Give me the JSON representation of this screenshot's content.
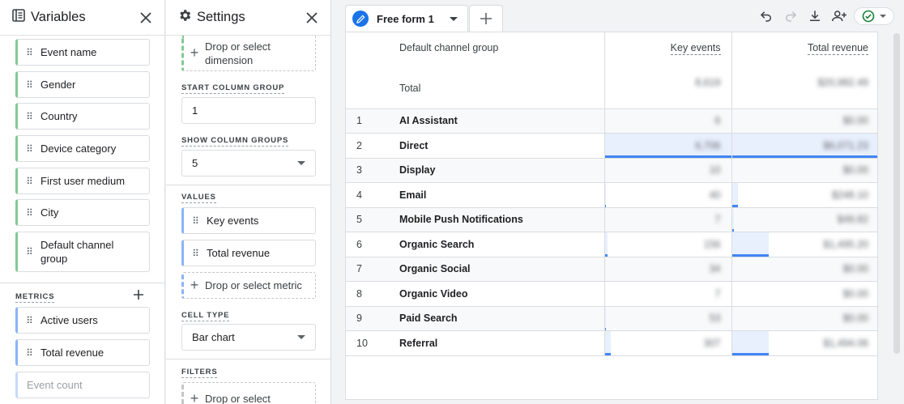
{
  "variables": {
    "title": "Variables",
    "dimensions": [
      "Event name",
      "Gender",
      "Country",
      "Device category",
      "First user medium",
      "City",
      "Default channel group"
    ],
    "metrics_label": "METRICS",
    "metrics": [
      "Active users",
      "Total revenue",
      "Event count"
    ]
  },
  "settings": {
    "title": "Settings",
    "drop_dimension": "Drop or select dimension",
    "start_column_group_label": "START COLUMN GROUP",
    "start_column_group_value": "1",
    "show_column_groups_label": "SHOW COLUMN GROUPS",
    "show_column_groups_value": "5",
    "values_label": "VALUES",
    "values": [
      "Key events",
      "Total revenue"
    ],
    "drop_metric": "Drop or select metric",
    "cell_type_label": "CELL TYPE",
    "cell_type_value": "Bar chart",
    "filters_label": "FILTERS",
    "drop_filter": "Drop or select"
  },
  "tabs": [
    {
      "label": "Free form 1"
    }
  ],
  "colors": {
    "accent": "#1a73e8",
    "dimension_chip": "#81c995",
    "metric_chip": "#8ab4f8",
    "bar_fill": "#e8f0fe",
    "bar_line": "#4285f4",
    "success": "#188038"
  },
  "table": {
    "dimension_header": "Default channel group",
    "metric_headers": [
      "Key events",
      "Total revenue"
    ],
    "total_label": "Total",
    "totals": [
      "8,619",
      "$20,982.49"
    ],
    "rows": [
      {
        "idx": "1",
        "name": "AI Assistant",
        "key_events": "6",
        "revenue": "$0.00",
        "ke_bar": 0,
        "rev_bar": 0
      },
      {
        "idx": "2",
        "name": "Direct",
        "key_events": "6,706",
        "revenue": "$6,071.23",
        "ke_bar": 1.0,
        "rev_bar": 1.0
      },
      {
        "idx": "3",
        "name": "Display",
        "key_events": "10",
        "revenue": "$0.00",
        "ke_bar": 0,
        "rev_bar": 0
      },
      {
        "idx": "4",
        "name": "Email",
        "key_events": "40",
        "revenue": "$248.10",
        "ke_bar": 0.01,
        "rev_bar": 0.04
      },
      {
        "idx": "5",
        "name": "Mobile Push Notifications",
        "key_events": "7",
        "revenue": "$49.82",
        "ke_bar": 0,
        "rev_bar": 0.01
      },
      {
        "idx": "6",
        "name": "Organic Search",
        "key_events": "156",
        "revenue": "$1,495.20",
        "ke_bar": 0.02,
        "rev_bar": 0.25
      },
      {
        "idx": "7",
        "name": "Organic Social",
        "key_events": "34",
        "revenue": "$0.00",
        "ke_bar": 0,
        "rev_bar": 0
      },
      {
        "idx": "8",
        "name": "Organic Video",
        "key_events": "7",
        "revenue": "$0.00",
        "ke_bar": 0,
        "rev_bar": 0
      },
      {
        "idx": "9",
        "name": "Paid Search",
        "key_events": "53",
        "revenue": "$0.00",
        "ke_bar": 0.01,
        "rev_bar": 0
      },
      {
        "idx": "10",
        "name": "Referral",
        "key_events": "307",
        "revenue": "$1,494.06",
        "ke_bar": 0.05,
        "rev_bar": 0.25
      }
    ]
  }
}
